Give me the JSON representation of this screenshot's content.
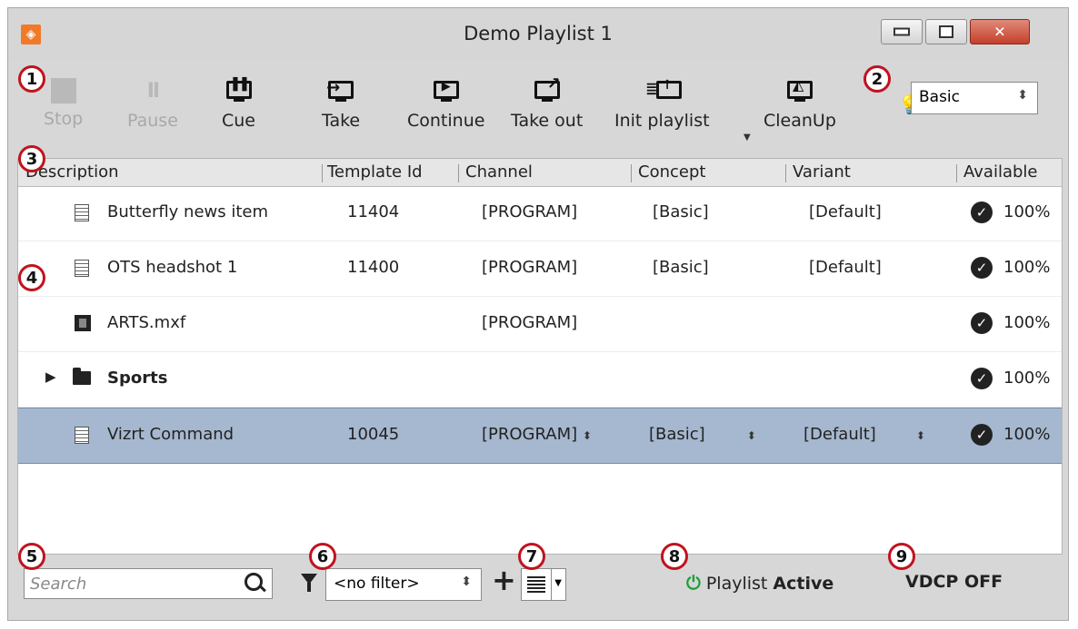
{
  "window": {
    "title": "Demo Playlist 1",
    "close_glyph": "✕"
  },
  "toolbar": {
    "buttons": [
      {
        "label": "Stop",
        "icon": "stop-icon",
        "enabled": false
      },
      {
        "label": "Pause",
        "icon": "pause-icon",
        "enabled": false
      },
      {
        "label": "Cue",
        "icon": "cue-icon",
        "enabled": true
      },
      {
        "label": "Take",
        "icon": "take-icon",
        "enabled": true
      },
      {
        "label": "Continue",
        "icon": "continue-icon",
        "enabled": true
      },
      {
        "label": "Take out",
        "icon": "take-out-icon",
        "enabled": true
      },
      {
        "label": "Init playlist",
        "icon": "init-playlist-icon",
        "enabled": true
      },
      {
        "label": "CleanUp",
        "icon": "cleanup-icon",
        "enabled": true
      }
    ],
    "mode_select": {
      "value": "Basic"
    }
  },
  "list": {
    "columns": [
      "Description",
      "Template Id",
      "Channel",
      "Concept",
      "Variant",
      "Available"
    ],
    "rows": [
      {
        "description": "Butterfly news item",
        "template_id": "11404",
        "channel": "[PROGRAM]",
        "concept": "[Basic]",
        "variant": "[Default]",
        "available": "100%",
        "type": "template",
        "selected": false
      },
      {
        "description": "OTS headshot 1",
        "template_id": "11400",
        "channel": "[PROGRAM]",
        "concept": "[Basic]",
        "variant": "[Default]",
        "available": "100%",
        "type": "template",
        "selected": false
      },
      {
        "description": "ARTS.mxf",
        "template_id": "",
        "channel": "[PROGRAM]",
        "concept": "",
        "variant": "",
        "available": "100%",
        "type": "video",
        "selected": false
      },
      {
        "description": "Sports",
        "template_id": "",
        "channel": "",
        "concept": "",
        "variant": "",
        "available": "100%",
        "type": "folder",
        "selected": false
      },
      {
        "description": "Vizrt Command",
        "template_id": "10045",
        "channel": "[PROGRAM]",
        "concept": "[Basic]",
        "variant": "[Default]",
        "available": "100%",
        "type": "template",
        "selected": true
      }
    ]
  },
  "bottom": {
    "search_placeholder": "Search",
    "filter_value": "<no filter>",
    "status_prefix": "Playlist",
    "status_value": "Active",
    "vdcp": "VDCP OFF"
  },
  "callouts": [
    "1",
    "2",
    "3",
    "4",
    "5",
    "6",
    "7",
    "8",
    "9"
  ],
  "colors": {
    "accent": "#c1121f",
    "selected_row": "#a6b8cf",
    "status_green": "#1b9e3a",
    "logo": "#f07a2a"
  }
}
